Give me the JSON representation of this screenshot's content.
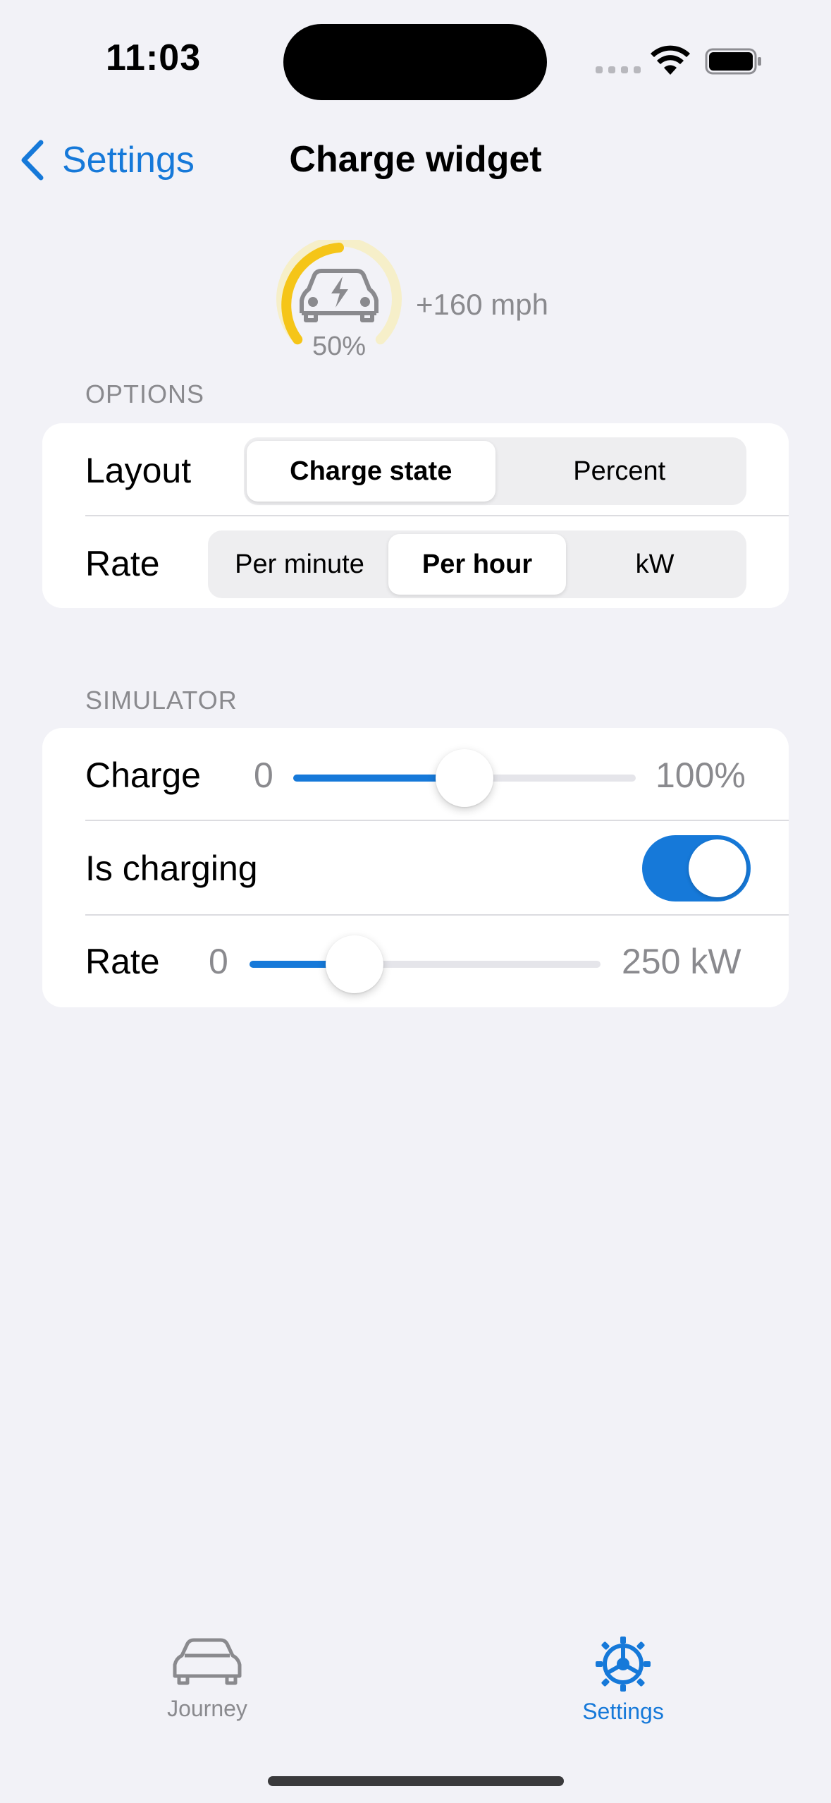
{
  "status_bar": {
    "time": "11:03"
  },
  "nav": {
    "back_label": "Settings",
    "title": "Charge widget"
  },
  "preview": {
    "percent_label": "50%",
    "rate_label": "+160 mph",
    "charge_fraction": 0.5,
    "colors": {
      "arc": "#f5c518",
      "arc_bg": "#f6efc9"
    },
    "icon": "car-charging-icon"
  },
  "options": {
    "header": "OPTIONS",
    "layout": {
      "label": "Layout",
      "options": [
        "Charge state",
        "Percent"
      ],
      "selected": "Charge state"
    },
    "rate": {
      "label": "Rate",
      "options": [
        "Per minute",
        "Per hour",
        "kW"
      ],
      "selected": "Per hour"
    }
  },
  "simulator": {
    "header": "SIMULATOR",
    "charge": {
      "label": "Charge",
      "min_label": "0",
      "max_label": "100%",
      "value": 0.5
    },
    "is_charging": {
      "label": "Is charging",
      "on": true
    },
    "rate": {
      "label": "Rate",
      "min_label": "0",
      "max_label": "250 kW",
      "value": 0.3
    }
  },
  "tab_bar": {
    "items": [
      {
        "label": "Journey",
        "icon": "car-icon",
        "active": false
      },
      {
        "label": "Settings",
        "icon": "gear-icon",
        "active": true
      }
    ]
  },
  "colors": {
    "accent": "#1679d9",
    "background": "#f2f2f7",
    "secondary_text": "#8a8a8e"
  }
}
